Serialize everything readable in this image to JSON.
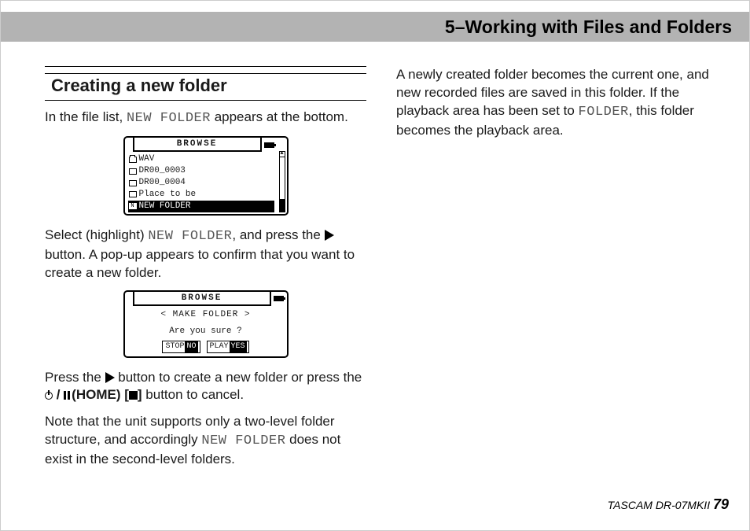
{
  "header": {
    "chapter_title": "5–Working with Files and Folders"
  },
  "left": {
    "section_title": "Creating a new folder",
    "p1_a": "In the file list, ",
    "p1_lcd": "NEW FOLDER",
    "p1_b": " appears at the bottom.",
    "screen1": {
      "title": "BROWSE",
      "rows": [
        "WAV",
        "DR00_0003",
        "DR00_0004",
        "Place to be",
        "NEW FOLDER"
      ]
    },
    "p2_a": "Select (highlight) ",
    "p2_lcd": "NEW FOLDER",
    "p2_b": ", and press the ",
    "p2_c": " button. A pop-up appears to confirm that you want to create a new folder.",
    "screen2": {
      "title": "BROWSE",
      "dialog_title": "< MAKE FOLDER >",
      "question": "Are you sure ?",
      "no_key": "STOP",
      "no_val": "NO",
      "yes_key": "PLAY",
      "yes_val": "YES"
    },
    "p3_a": "Press the ",
    "p3_b": " button to create a new folder or press the ",
    "p3_home": "(HOME)",
    "p3_c": " button to cancel.",
    "p4_a": "Note that the unit supports only a two-level folder structure, and accordingly ",
    "p4_lcd": "NEW FOLDER",
    "p4_b": " does not exist in the second-level folders."
  },
  "right": {
    "p1_a": "A newly created folder becomes the current one, and new recorded files are saved in this folder. If the playback area has been set to ",
    "p1_lcd": "FOLDER",
    "p1_b": ", this folder becomes the playback area."
  },
  "footer": {
    "model": "TASCAM DR-07MKII ",
    "page": "79"
  }
}
